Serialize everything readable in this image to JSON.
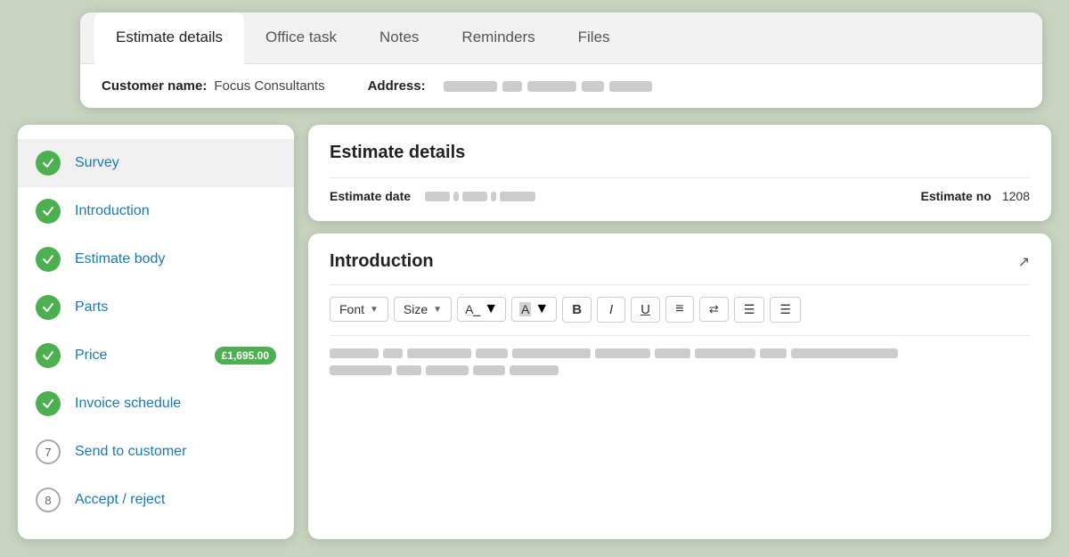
{
  "topCard": {
    "tabs": [
      {
        "label": "Estimate details",
        "active": true
      },
      {
        "label": "Office task",
        "active": false
      },
      {
        "label": "Notes",
        "active": false
      },
      {
        "label": "Reminders",
        "active": false
      },
      {
        "label": "Files",
        "active": false
      }
    ],
    "customerLabel": "Customer name:",
    "customerValue": "Focus Consultants",
    "addressLabel": "Address:"
  },
  "sidebar": {
    "items": [
      {
        "type": "check",
        "label": "Survey",
        "active": true
      },
      {
        "type": "check",
        "label": "Introduction",
        "active": false
      },
      {
        "type": "check",
        "label": "Estimate body",
        "active": false
      },
      {
        "type": "check",
        "label": "Parts",
        "active": false
      },
      {
        "type": "check",
        "label": "Price",
        "badge": "£1,695.00",
        "active": false
      },
      {
        "type": "check",
        "label": "Invoice schedule",
        "active": false
      },
      {
        "type": "num",
        "num": "7",
        "label": "Send to customer",
        "active": false
      },
      {
        "type": "num",
        "num": "8",
        "label": "Accept / reject",
        "active": false
      }
    ]
  },
  "estimateDetails": {
    "title": "Estimate details",
    "estimateDateLabel": "Estimate date",
    "estimateNoLabel": "Estimate no",
    "estimateNoValue": "1208"
  },
  "introduction": {
    "title": "Introduction",
    "toolbar": {
      "fontLabel": "Font",
      "sizeLabel": "Size",
      "fontColorLabel": "A_",
      "highlightLabel": "A",
      "boldLabel": "B",
      "italicLabel": "I",
      "underlineLabel": "U"
    }
  }
}
